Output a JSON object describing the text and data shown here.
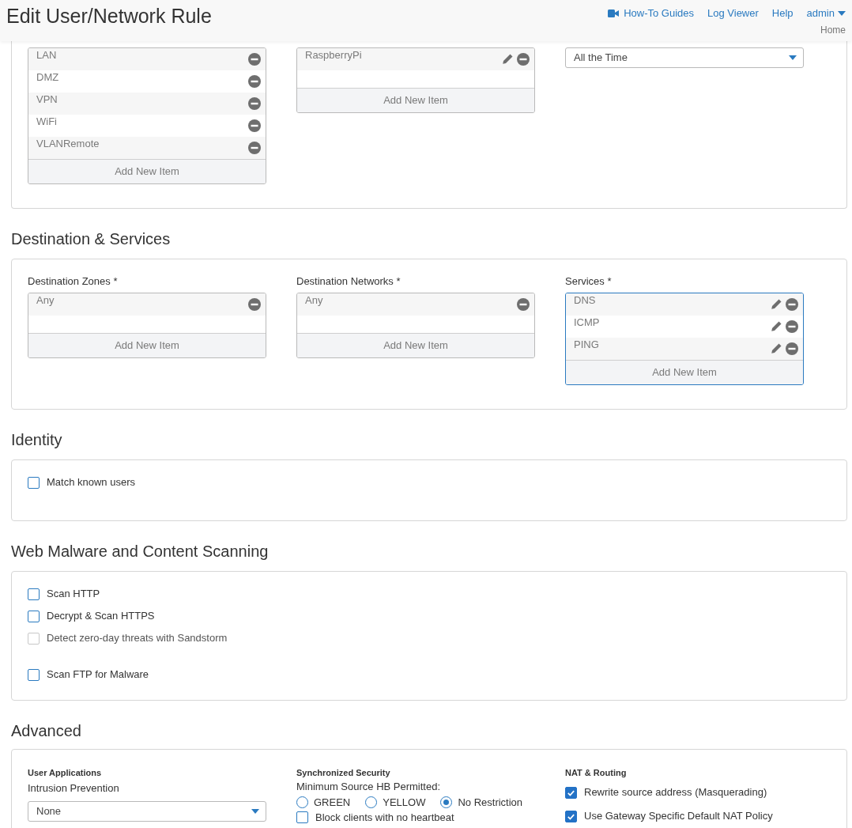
{
  "header": {
    "title": "Edit User/Network Rule",
    "links": [
      {
        "label": "How-To Guides",
        "kind": "video"
      },
      {
        "label": "Log Viewer",
        "kind": "plain"
      },
      {
        "label": "Help",
        "kind": "plain"
      }
    ],
    "user": "admin",
    "user_sub": "Home"
  },
  "top_section": {
    "columns": [
      {
        "kind": "list",
        "focused": false,
        "items": [
          {
            "label": "LAN",
            "editable": false
          },
          {
            "label": "DMZ",
            "editable": false
          },
          {
            "label": "VPN",
            "editable": false
          },
          {
            "label": "WiFi",
            "editable": false
          },
          {
            "label": "VLANRemote",
            "editable": false
          }
        ],
        "add_label": "Add New Item"
      },
      {
        "kind": "list",
        "focused": false,
        "items": [
          {
            "label": "RaspberryPi",
            "editable": true
          }
        ],
        "add_label": "Add New Item"
      },
      {
        "kind": "select",
        "value": "All the Time"
      }
    ]
  },
  "destination": {
    "title": "Destination & Services",
    "columns": [
      {
        "kind": "list",
        "label": "Destination Zones *",
        "focused": false,
        "items": [
          {
            "label": "Any",
            "editable": false
          }
        ],
        "add_label": "Add New Item"
      },
      {
        "kind": "list",
        "label": "Destination Networks *",
        "focused": false,
        "items": [
          {
            "label": "Any",
            "editable": false
          }
        ],
        "add_label": "Add New Item"
      },
      {
        "kind": "list",
        "label": "Services *",
        "focused": true,
        "items": [
          {
            "label": "DNS",
            "editable": true
          },
          {
            "label": "ICMP",
            "editable": true
          },
          {
            "label": "PING",
            "editable": true
          }
        ],
        "add_label": "Add New Item"
      }
    ]
  },
  "identity": {
    "title": "Identity",
    "groups": [
      [
        {
          "label": "Match known users",
          "checked": false,
          "disabled": false
        }
      ]
    ]
  },
  "scanning": {
    "title": "Web Malware and Content Scanning",
    "groups": [
      [
        {
          "label": "Scan HTTP",
          "checked": false,
          "disabled": false
        },
        {
          "label": "Decrypt & Scan HTTPS",
          "checked": false,
          "disabled": false
        },
        {
          "label": "Detect zero-day threats with Sandstorm",
          "checked": false,
          "disabled": true
        }
      ],
      [
        {
          "label": "Scan FTP for Malware",
          "checked": false,
          "disabled": false
        }
      ]
    ]
  },
  "advanced": {
    "title": "Advanced",
    "user_applications": {
      "heading": "User Applications",
      "label": "Intrusion Prevention",
      "select": "None"
    },
    "synchronized_security": {
      "heading": "Synchronized Security",
      "label": "Minimum Source HB Permitted:",
      "radios": [
        {
          "label": "GREEN",
          "selected": false
        },
        {
          "label": "YELLOW",
          "selected": false
        },
        {
          "label": "No Restriction",
          "selected": true
        }
      ],
      "checkbox": {
        "label": "Block clients with no heartbeat",
        "checked": false
      }
    },
    "nat_routing": {
      "heading": "NAT & Routing",
      "checkboxes": [
        {
          "label": "Rewrite source address (Masquerading)",
          "checked": true
        },
        {
          "label": "Use Gateway Specific Default NAT Policy",
          "checked": true
        }
      ]
    }
  }
}
